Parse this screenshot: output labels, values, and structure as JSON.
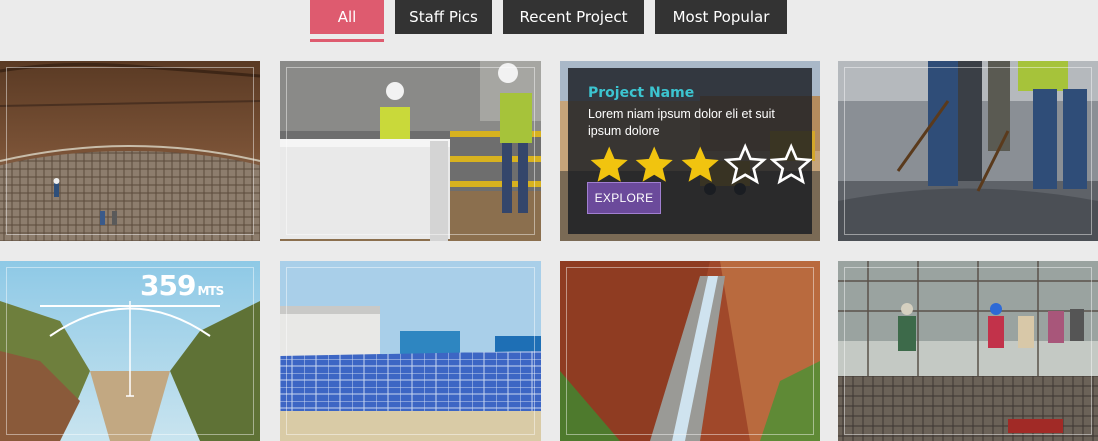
{
  "filters": [
    {
      "label": "All",
      "active": true
    },
    {
      "label": "Staff Pics",
      "active": false
    },
    {
      "label": "Recent Project",
      "active": false
    },
    {
      "label": "Most Popular",
      "active": false
    }
  ],
  "overlay": {
    "title": "Project Name",
    "description": "Lorem niam ipsum dolor eli et suit ipsum dolore",
    "rating": 3,
    "rating_max": 5,
    "button_label": "EXPLORE"
  },
  "bridge_label": "359",
  "bridge_unit": "MTS",
  "colors": {
    "accent": "#de5b6f",
    "inactive": "#333333",
    "title": "#3cc4d0",
    "explore": "#6b4a9b"
  }
}
